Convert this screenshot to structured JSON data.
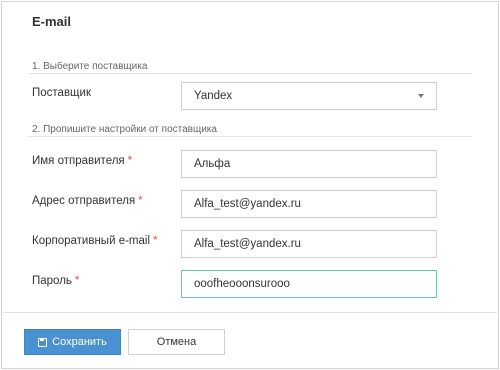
{
  "dialog": {
    "title": "E-mail"
  },
  "section1": {
    "heading": "1. Выберите поставщика"
  },
  "provider": {
    "label": "Поставщик",
    "value": "Yandex",
    "icon": "chevron-down-icon"
  },
  "section2": {
    "heading": "2. Пропишите настройки от поставщика"
  },
  "fields": {
    "sender_name": {
      "label": "Имя отправителя",
      "required_mark": "*",
      "value": "Альфа"
    },
    "sender_address": {
      "label": "Адрес отправителя",
      "required_mark": "*",
      "value": "Alfa_test@yandex.ru"
    },
    "corporate_email": {
      "label": "Корпоративный e-mail",
      "required_mark": "*",
      "value": "Alfa_test@yandex.ru"
    },
    "password": {
      "label": "Пароль",
      "required_mark": "*",
      "value": "ooofheooonsurooo"
    }
  },
  "actions": {
    "save_label": "Сохранить",
    "save_icon": "floppy-disk-icon",
    "cancel_label": "Отмена"
  },
  "colors": {
    "primary": "#4a91d2",
    "required": "#d9534f",
    "focus_border": "#6cc3a7"
  }
}
